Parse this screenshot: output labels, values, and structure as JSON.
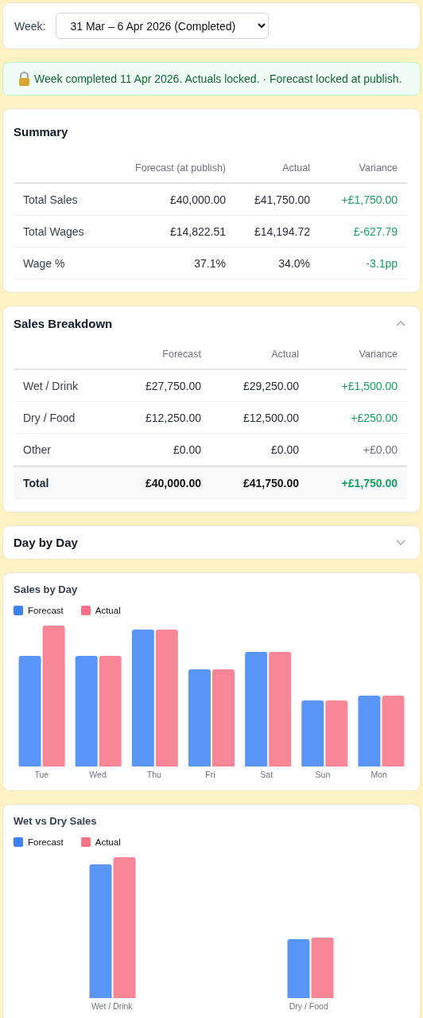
{
  "week_picker": {
    "label": "Week:",
    "value": "31 Mar – 6 Apr 2026 (Completed)"
  },
  "notice": {
    "text": "Week completed 11 Apr 2026. Actuals locked. · Forecast locked at publish."
  },
  "summary": {
    "title": "Summary",
    "columns": [
      "Forecast (at publish)",
      "Actual",
      "Variance"
    ],
    "rows": [
      {
        "kind": "normal",
        "label": "Total Sales",
        "forecast": "£40,000.00",
        "actual": "£41,750.00",
        "variance": "+£1,750.00",
        "color": "#16a05e"
      },
      {
        "kind": "normal",
        "label": "Total Wages",
        "forecast": "£14,822.51",
        "actual": "£14,194.72",
        "variance": "£-627.79",
        "color": "#16a05e"
      },
      {
        "kind": "normal",
        "label": "Wage %",
        "forecast": "37.1%",
        "actual": "34.0%",
        "variance": "-3.1pp",
        "color": "#16a05e"
      }
    ]
  },
  "sales_breakdown": {
    "title": "Sales Breakdown",
    "expanded": true,
    "columns": [
      "Forecast",
      "Actual",
      "Variance"
    ],
    "rows": [
      {
        "kind": "normal",
        "label": "Wet / Drink",
        "forecast": "£27,750.00",
        "actual": "£29,250.00",
        "variance": "+£1,500.00",
        "color": "#16a05e"
      },
      {
        "kind": "normal",
        "label": "Dry / Food",
        "forecast": "£12,250.00",
        "actual": "£12,500.00",
        "variance": "+£250.00",
        "color": "#16a05e"
      },
      {
        "kind": "normal",
        "label": "Other",
        "forecast": "£0.00",
        "actual": "£0.00",
        "variance": "+£0.00",
        "color": "#6b7280"
      },
      {
        "kind": "total",
        "label": "Total",
        "forecast": "£40,000.00",
        "actual": "£41,750.00",
        "variance": "+£1,750.00",
        "color": "#16a05e"
      }
    ]
  },
  "day_by_day": {
    "title": "Day by Day",
    "expanded": false
  },
  "sales_by_day": {
    "title": "Sales by Day",
    "legend": [
      {
        "label": "Forecast",
        "color": "#3b82f6"
      },
      {
        "label": "Actual",
        "color": "#f87185"
      }
    ],
    "categories": [
      "Tue",
      "Wed",
      "Thu",
      "Fri",
      "Sat",
      "Sun",
      "Mon"
    ]
  },
  "wet_vs_dry": {
    "title": "Wet vs Dry Sales",
    "legend": [
      {
        "label": "Forecast",
        "color": "#3b82f6"
      },
      {
        "label": "Actual",
        "color": "#f87185"
      }
    ],
    "categories": [
      "Wet / Drink",
      "Dry / Food"
    ]
  }
}
